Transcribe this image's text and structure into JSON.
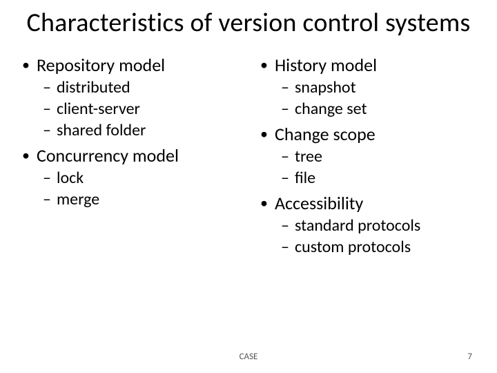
{
  "title": "Characteristics of version control systems",
  "left": {
    "b0": {
      "label": "Repository model",
      "s0": "distributed",
      "s1": "client-server",
      "s2": "shared folder"
    },
    "b1": {
      "label": "Concurrency model",
      "s0": "lock",
      "s1": "merge"
    }
  },
  "right": {
    "b0": {
      "label": "History model",
      "s0": "snapshot",
      "s1": "change set"
    },
    "b1": {
      "label": "Change scope",
      "s0": "tree",
      "s1": "file"
    },
    "b2": {
      "label": "Accessibility",
      "s0": "standard protocols",
      "s1": "custom protocols"
    }
  },
  "footer": {
    "center": "CASE",
    "page": "7"
  }
}
